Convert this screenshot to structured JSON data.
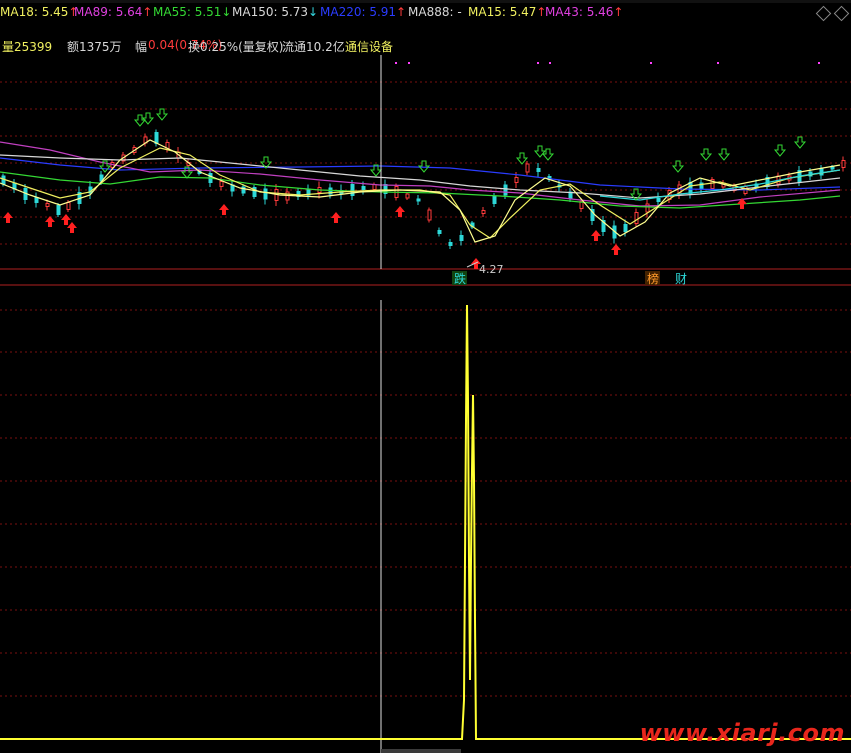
{
  "ma_legend": [
    {
      "id": "ma18",
      "label": "MA18: 5.45",
      "arrow": "↑",
      "color": "#f0f060",
      "arrow_color": "#ff3b3b"
    },
    {
      "id": "ma89",
      "label": "MA89: 5.64",
      "arrow": "↑",
      "color": "#e040e0",
      "arrow_color": "#ff3b3b"
    },
    {
      "id": "ma55",
      "label": "MA55: 5.51",
      "arrow": "↓",
      "color": "#34d834",
      "arrow_color": "#34d834"
    },
    {
      "id": "ma150",
      "label": "MA150: 5.73",
      "arrow": "↓",
      "color": "#d8d8d8",
      "arrow_color": "#34d8e0"
    },
    {
      "id": "ma220",
      "label": "MA220: 5.91",
      "arrow": "↑",
      "color": "#2a3cff",
      "arrow_color": "#ff3b3b"
    },
    {
      "id": "ma888",
      "label": "MA888: -",
      "arrow": "",
      "color": "#d8d8d8",
      "arrow_color": "#d8d8d8"
    },
    {
      "id": "ma15",
      "label": "MA15: 5.47",
      "arrow": "↑",
      "color": "#f0f060",
      "arrow_color": "#ff3b3b"
    },
    {
      "id": "ma43",
      "label": "MA43: 5.46",
      "arrow": "↑",
      "color": "#e040e0",
      "arrow_color": "#ff3b3b"
    }
  ],
  "info": {
    "volume": "量25399",
    "amount": "额1375万",
    "amplitude_label": "幅",
    "amplitude_value": "0.04(0.74%)",
    "turnover": "换0.25%(量复权)",
    "float_cap": "流通10.2亿",
    "sector": "通信设备"
  },
  "markers": {
    "low_price": "4.27",
    "tag_die": "跌",
    "tag_bang": "榜",
    "tag_cai": "财"
  },
  "watermark": "www.xiarj.com",
  "colors": {
    "background": "#000000",
    "up": "#ff3b3b",
    "down": "#2dd8d8",
    "grid": "#7a1010",
    "indicator_line": "#ffff33",
    "crosshair": "#e0e0e0"
  }
}
